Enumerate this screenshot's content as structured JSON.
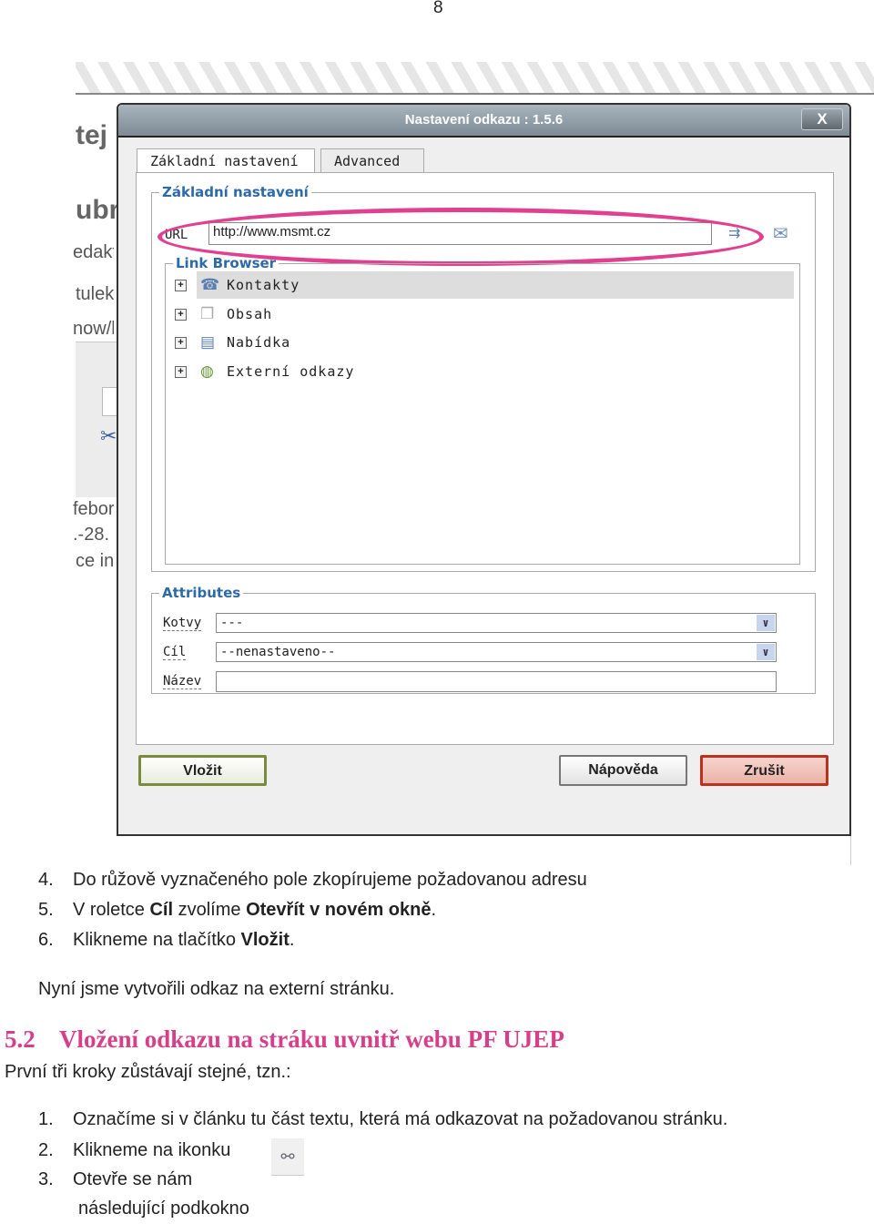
{
  "page_number": "8",
  "background_fragments": [
    "tej",
    "ubr",
    "edakt",
    "tulek",
    "now/h",
    "febor",
    ".-28.",
    "ce in"
  ],
  "dialog": {
    "title": "Nastavení odkazu : 1.5.6",
    "close_label": "X",
    "tabs": [
      {
        "label": "Základní nastavení",
        "active": true
      },
      {
        "label": "Advanced",
        "active": false
      }
    ],
    "basic_legend": "Základní nastavení",
    "url_label": "URL",
    "url_value": "http://www.msmt.cz",
    "highlight_color": "#e0408f",
    "link_browser": {
      "legend": "Link Browser",
      "items": [
        {
          "label": "Kontakty",
          "icon": "contacts-icon",
          "selected": true
        },
        {
          "label": "Obsah",
          "icon": "pages-icon",
          "selected": false
        },
        {
          "label": "Nabídka",
          "icon": "menu-icon",
          "selected": false
        },
        {
          "label": "Externí odkazy",
          "icon": "globe-icon",
          "selected": false
        }
      ]
    },
    "attributes": {
      "legend": "Attributes",
      "anchor_label": "Kotvy",
      "anchor_value": "---",
      "target_label": "Cíl",
      "target_value": "--nenastaveno--",
      "name_label": "Název",
      "name_value": ""
    },
    "buttons": {
      "insert": "Vložit",
      "help": "Nápověda",
      "cancel": "Zrušit"
    }
  },
  "steps_a": [
    {
      "num": "4.",
      "text": "Do růžově vyznačeného pole zkopírujeme požadovanou adresu"
    },
    {
      "num": "5.",
      "pre": "V roletce ",
      "b1": "Cíl",
      "mid": " zvolíme ",
      "b2": "Otevřít v novém okně",
      "post": "."
    },
    {
      "num": "6.",
      "pre": "Klikneme na tlačítko ",
      "b1": "Vložit",
      "post": "."
    }
  ],
  "summary": "Nyní jsme vytvořili odkaz na externí stránku.",
  "section": {
    "number": "5.2",
    "title": "Vložení odkazu na stráku uvnitř webu PF UJEP",
    "color": "#d6408a"
  },
  "intro": "První tři kroky zůstávají stejné, tzn.:",
  "steps_b": [
    {
      "num": "1.",
      "text": "Označíme si v článku tu část textu, která má odkazovat na požadovanou stránku."
    },
    {
      "num": "2.",
      "text": "Klikneme na ikonku"
    },
    {
      "num": "3.",
      "text": "Otevře se nám"
    }
  ],
  "steps_b_continuation": "následující podkokno"
}
